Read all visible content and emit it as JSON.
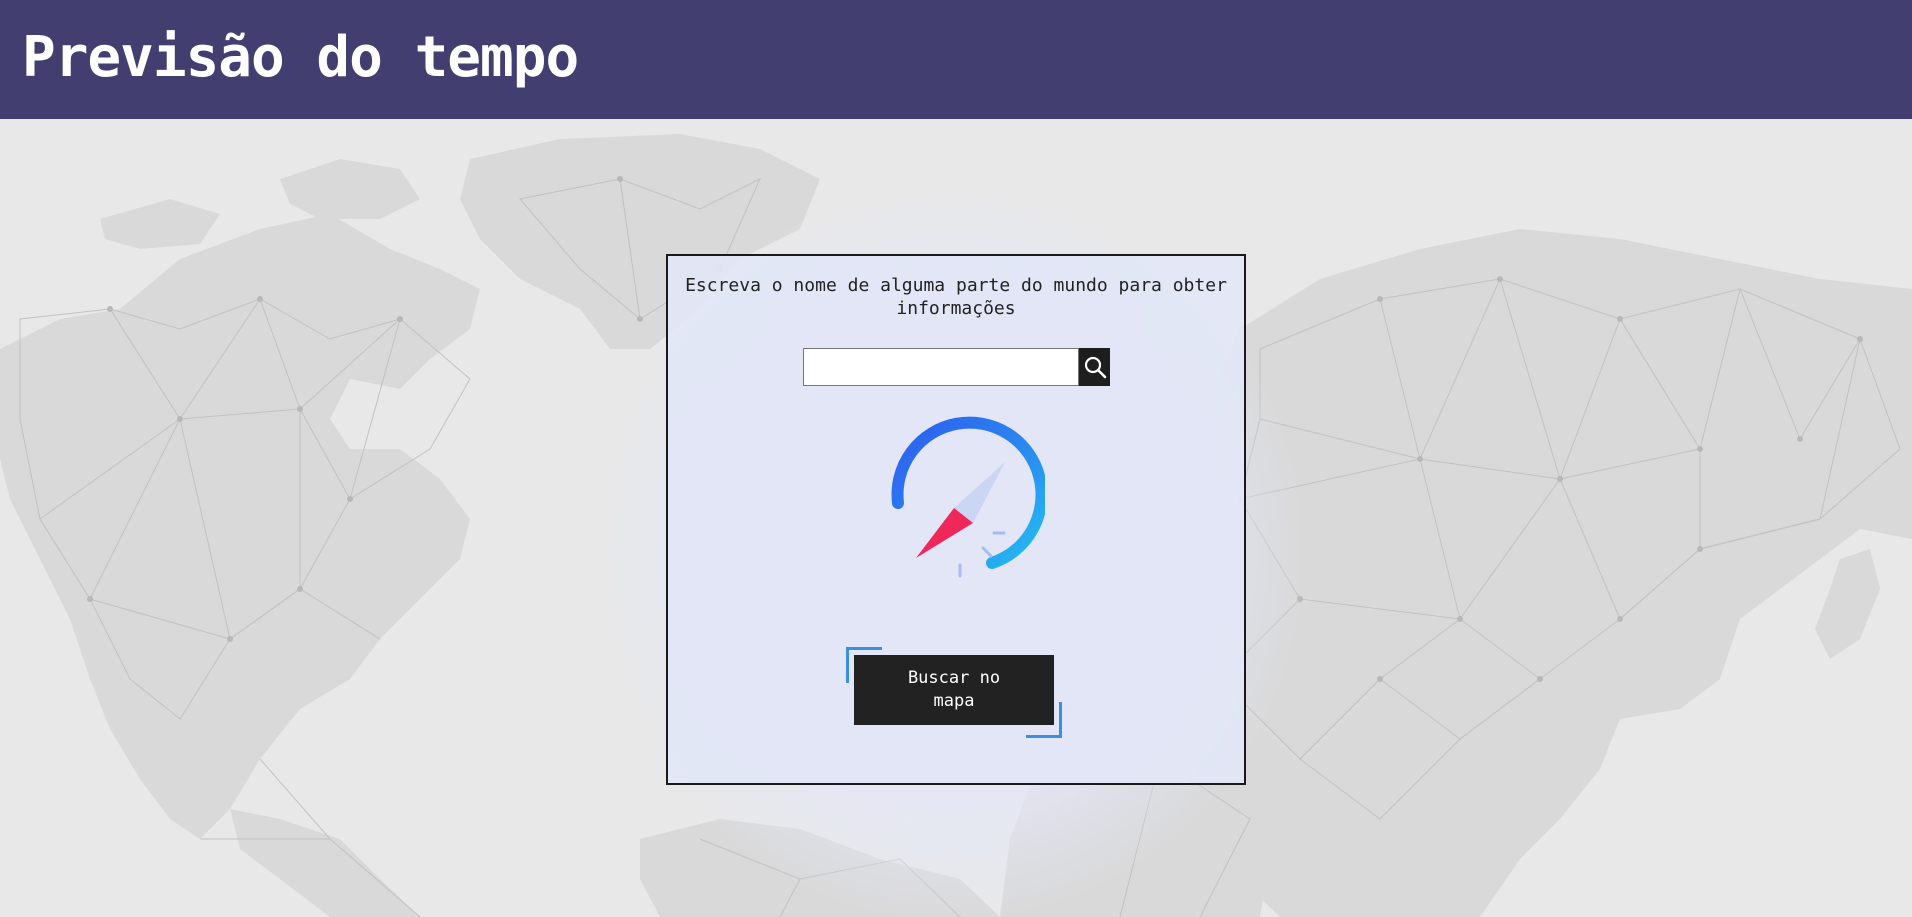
{
  "header": {
    "title": "Previsão do tempo"
  },
  "main": {
    "instruction": "Escreva o nome de alguma parte do mundo para obter informações",
    "search": {
      "value": "",
      "placeholder": "",
      "button_icon": "search-icon"
    },
    "illustration_icon": "compass-icon",
    "map_button_label": "Buscar no mapa"
  },
  "colors": {
    "header_bg": "#423e70",
    "page_bg": "#e8e8e8",
    "card_bg": "#e2e6f6",
    "button_bg": "#222222",
    "accent_blue": "#3a8fe0",
    "compass_red": "#f0285a"
  }
}
